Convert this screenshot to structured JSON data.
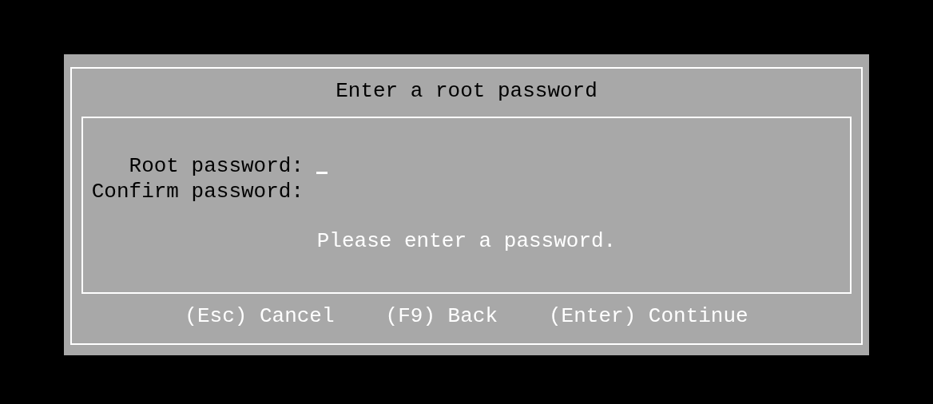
{
  "dialog": {
    "title": "Enter a root password",
    "fields": [
      {
        "label": "Root password:",
        "focused": true
      },
      {
        "label": "Confirm password:",
        "focused": false
      }
    ],
    "message": "Please enter a password.",
    "actions": [
      "(Esc) Cancel",
      "(F9) Back",
      "(Enter) Continue"
    ]
  }
}
